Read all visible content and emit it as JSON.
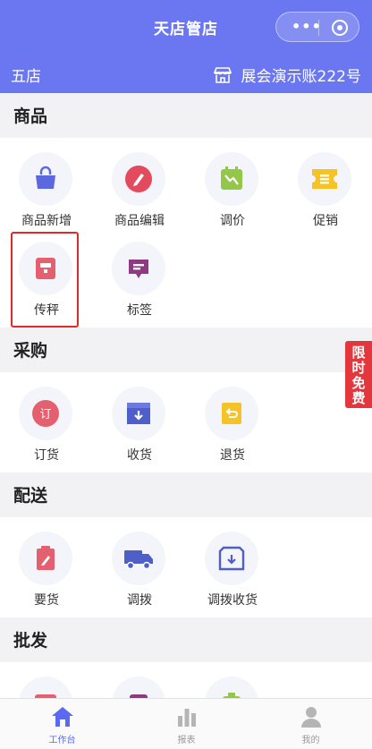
{
  "navbar": {
    "title": "天店管店"
  },
  "store": {
    "name": "五店",
    "account": "展会演示账222号"
  },
  "sections": [
    {
      "title": "商品",
      "items": [
        {
          "label": "商品新增",
          "icon": "bag-icon"
        },
        {
          "label": "商品编辑",
          "icon": "edit-pen-icon"
        },
        {
          "label": "调价",
          "icon": "price-trend-icon"
        },
        {
          "label": "促销",
          "icon": "coupon-icon"
        },
        {
          "label": "传秤",
          "icon": "scale-icon"
        },
        {
          "label": "标签",
          "icon": "tag-icon"
        }
      ]
    },
    {
      "title": "采购",
      "items": [
        {
          "label": "订货",
          "icon": "order-icon"
        },
        {
          "label": "收货",
          "icon": "receive-box-icon"
        },
        {
          "label": "退货",
          "icon": "return-box-icon"
        }
      ]
    },
    {
      "title": "配送",
      "items": [
        {
          "label": "要货",
          "icon": "request-clipboard-icon"
        },
        {
          "label": "调拨",
          "icon": "truck-icon"
        },
        {
          "label": "调拨收货",
          "icon": "transfer-receive-icon"
        }
      ]
    },
    {
      "title": "批发",
      "items": []
    }
  ],
  "icon_glyphs": {
    "order": "订"
  },
  "promo": {
    "chars": [
      "限",
      "时",
      "免",
      "费"
    ]
  },
  "tabs": [
    {
      "label": "工作台",
      "icon": "home-icon",
      "active": true
    },
    {
      "label": "报表",
      "icon": "bar-chart-icon",
      "active": false
    },
    {
      "label": "我的",
      "icon": "user-icon",
      "active": false
    }
  ],
  "colors": {
    "brand": "#6b77f0",
    "active_tab": "#5a6af0",
    "highlight_border": "#e02a2a",
    "promo": "#e4363d"
  }
}
